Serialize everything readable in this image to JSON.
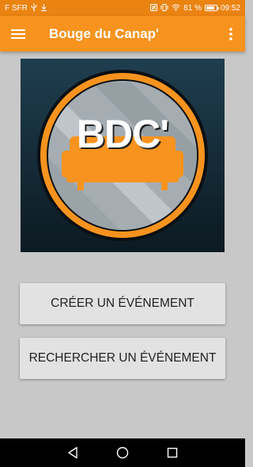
{
  "status_bar": {
    "carrier": "F SFR",
    "battery_percent": "81 %",
    "battery_level": 0.81,
    "time": "09:52",
    "icons": [
      "usb-icon",
      "download-icon",
      "nfc-icon",
      "vibrate-icon",
      "wifi-icon",
      "battery-icon"
    ]
  },
  "app_bar": {
    "title": "Bouge du Canap'",
    "menu_icon": "hamburger-menu-icon",
    "overflow_icon": "more-vert-icon"
  },
  "logo": {
    "text": "BDC'",
    "icon": "couch-logo"
  },
  "buttons": {
    "create_label": "CRÉER UN ÉVÉNEMENT",
    "search_label": "RECHERCHER UN ÉVÉNEMENT"
  },
  "nav_bar": {
    "icons": [
      "back-icon",
      "home-icon",
      "recents-icon"
    ]
  },
  "colors": {
    "accent": "#f7931e",
    "status": "#ea8312",
    "background": "#c8c8c8",
    "button": "#e2e2e2"
  }
}
